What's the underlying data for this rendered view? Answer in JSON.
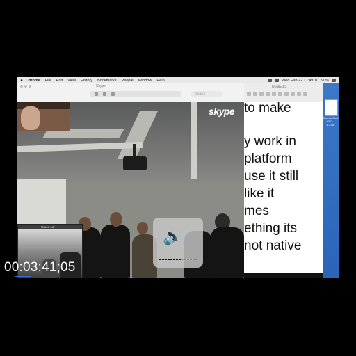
{
  "menubar": {
    "items": [
      "Chrome",
      "File",
      "Edit",
      "View",
      "History",
      "Bookmarks",
      "People",
      "Window",
      "Help"
    ],
    "clock": "Wed Feb 22  17:48:10",
    "battery": "90%"
  },
  "skype": {
    "window_title": "Skype",
    "search_placeholder": "Search",
    "logo_text": "skype",
    "pip_label": "Grace Lai"
  },
  "volume_osd": {
    "icon": "speaker-volume-icon",
    "level": 0.6,
    "segments": 16
  },
  "document": {
    "window_title": "Untitled 3",
    "lines": [
      "to make",
      "",
      "y work in",
      "platform",
      "use it still",
      " like it",
      "mes",
      "ething its",
      " not native"
    ]
  },
  "desktop": {
    "file_label": "Screen Shot 2017... 17.48"
  },
  "timecode": "00:03:41;05",
  "colors": {
    "desktop_blue": "#3b78c9",
    "timecode_bar": "#3a6fd6"
  }
}
